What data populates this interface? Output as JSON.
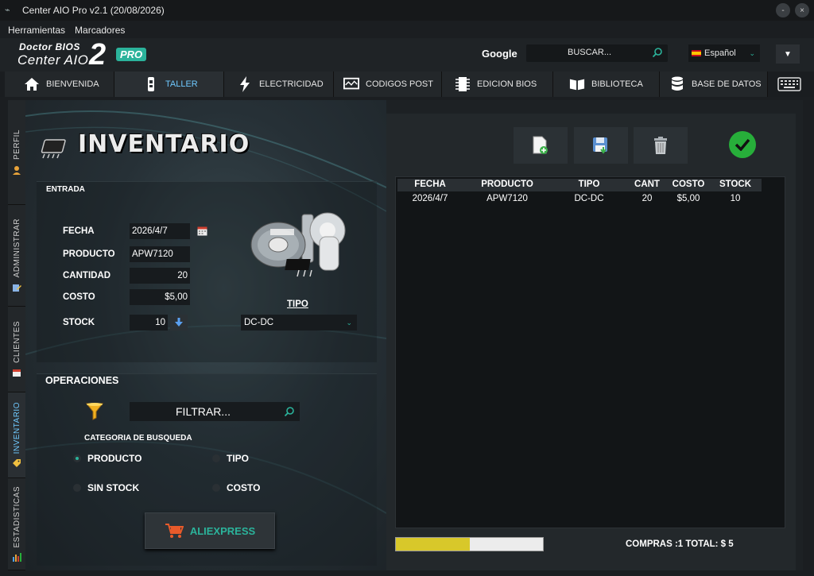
{
  "window": {
    "title": "Center AIO Pro v2.1 (20/08/2026)",
    "minimize": "-",
    "close": "×"
  },
  "menubar": {
    "items": [
      "Herramientas",
      "Marcadores"
    ]
  },
  "header": {
    "logo_line1": "Doctor BIOS",
    "logo_line2": "Center AIO",
    "logo_big": "2",
    "logo_badge": "PRO",
    "google_label": "Google",
    "search_placeholder": "BUSCAR...",
    "language": "Español"
  },
  "tabs": [
    {
      "label": "BIENVENIDA",
      "icon": "home-icon"
    },
    {
      "label": "TALLER",
      "icon": "tools-icon",
      "active": true
    },
    {
      "label": "ELECTRICIDAD",
      "icon": "lightning-icon"
    },
    {
      "label": "CODIGOS POST",
      "icon": "code-monitor-icon"
    },
    {
      "label": "EDICION BIOS",
      "icon": "chip-icon"
    },
    {
      "label": "BIBLIOTECA",
      "icon": "book-icon"
    },
    {
      "label": "BASE DE DATOS",
      "icon": "database-icon"
    }
  ],
  "side_tabs": [
    {
      "label": "PERFIL",
      "icon": "user-icon"
    },
    {
      "label": "ADMINISTRAR",
      "icon": "edit-icon"
    },
    {
      "label": "CLIENTES",
      "icon": "calendar-icon"
    },
    {
      "label": "INVENTARIO",
      "icon": "tag-icon",
      "active": true
    },
    {
      "label": "ESTADISTICAS",
      "icon": "chart-icon"
    }
  ],
  "inventario": {
    "title": "INVENTARIO",
    "entrada_label": "ENTRADA",
    "fields": {
      "fecha_label": "FECHA",
      "fecha_value": "2026/4/7",
      "producto_label": "PRODUCTO",
      "producto_value": "APW7120",
      "cantidad_label": "CANTIDAD",
      "cantidad_value": "20",
      "costo_label": "COSTO",
      "costo_value": "$5,00",
      "stock_label": "STOCK",
      "stock_value": "10"
    },
    "tipo_label": "TIPO",
    "tipo_value": "DC-DC"
  },
  "operaciones": {
    "title": "OPERACIONES",
    "filter_placeholder": "FILTRAR...",
    "category_label": "CATEGORIA DE BUSQUEDA",
    "options": [
      {
        "label": "PRODUCTO",
        "selected": true
      },
      {
        "label": "TIPO",
        "selected": false
      },
      {
        "label": "SIN STOCK",
        "selected": false
      },
      {
        "label": "COSTO",
        "selected": false
      }
    ],
    "aliexpress_label": "ALIEXPRESS"
  },
  "table": {
    "columns": [
      "FECHA",
      "PRODUCTO",
      "TIPO",
      "CANT",
      "COSTO",
      "STOCK"
    ],
    "rows": [
      [
        "2026/4/7",
        "APW7120",
        "DC-DC",
        "20",
        "$5,00",
        "10"
      ]
    ]
  },
  "footer": {
    "progress": 0.5,
    "summary": "COMPRAS :1  TOTAL: $ 5"
  },
  "colors": {
    "accent": "#2bb39b",
    "active_tab": "#6fc9ff",
    "progress_fill": "#d8c82a",
    "confirm": "#27ae3a"
  }
}
